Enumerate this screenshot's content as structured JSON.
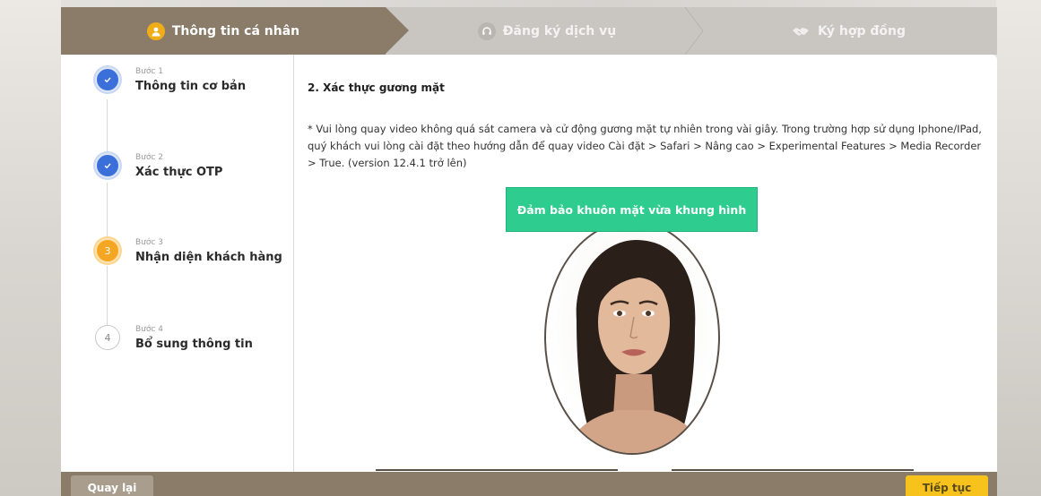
{
  "stepper": {
    "steps": [
      {
        "label": "Thông tin cá nhân",
        "state": "active",
        "icon": "person-icon"
      },
      {
        "label": "Đăng ký dịch vụ",
        "state": "inactive",
        "icon": "headset-icon"
      },
      {
        "label": "Ký hợp đồng",
        "state": "inactive",
        "icon": "handshake-icon"
      }
    ],
    "active_color": "#8a7c68",
    "inactive_color": "#c9c6c2"
  },
  "sidebar": {
    "steps": [
      {
        "number": "",
        "label": "Bước 1",
        "name": "Thông tin cơ bản",
        "state": "done"
      },
      {
        "number": "",
        "label": "Bước 2",
        "name": "Xác thực OTP",
        "state": "done"
      },
      {
        "number": "3",
        "label": "Bước 3",
        "name": "Nhận diện khách hàng",
        "state": "current"
      },
      {
        "number": "4",
        "label": "Bước 4",
        "name": "Bổ sung thông tin",
        "state": "todo"
      }
    ],
    "colors": {
      "done": "#3b6fd9",
      "current": "#f5a623"
    }
  },
  "main": {
    "title": "2. Xác thực gương mặt",
    "note": "* Vui lòng quay video không quá sát camera và cử động gương mặt tự nhiên trong vài giây. Trong trường hợp sử dụng Iphone/IPad, quý khách vui lòng cài đặt theo hướng dẫn để quay video Cài đặt > Safari > Nâng cao > Experimental Features > Media Recorder > True. (version 12.4.1 trở lên)",
    "face_hint": "Đảm bảo khuôn mặt vừa khung hình",
    "hint_color": "#2fcc8f"
  },
  "footer": {
    "back_label": "Quay lại",
    "next_label": "Tiếp tục",
    "next_color": "#f7c21c"
  }
}
